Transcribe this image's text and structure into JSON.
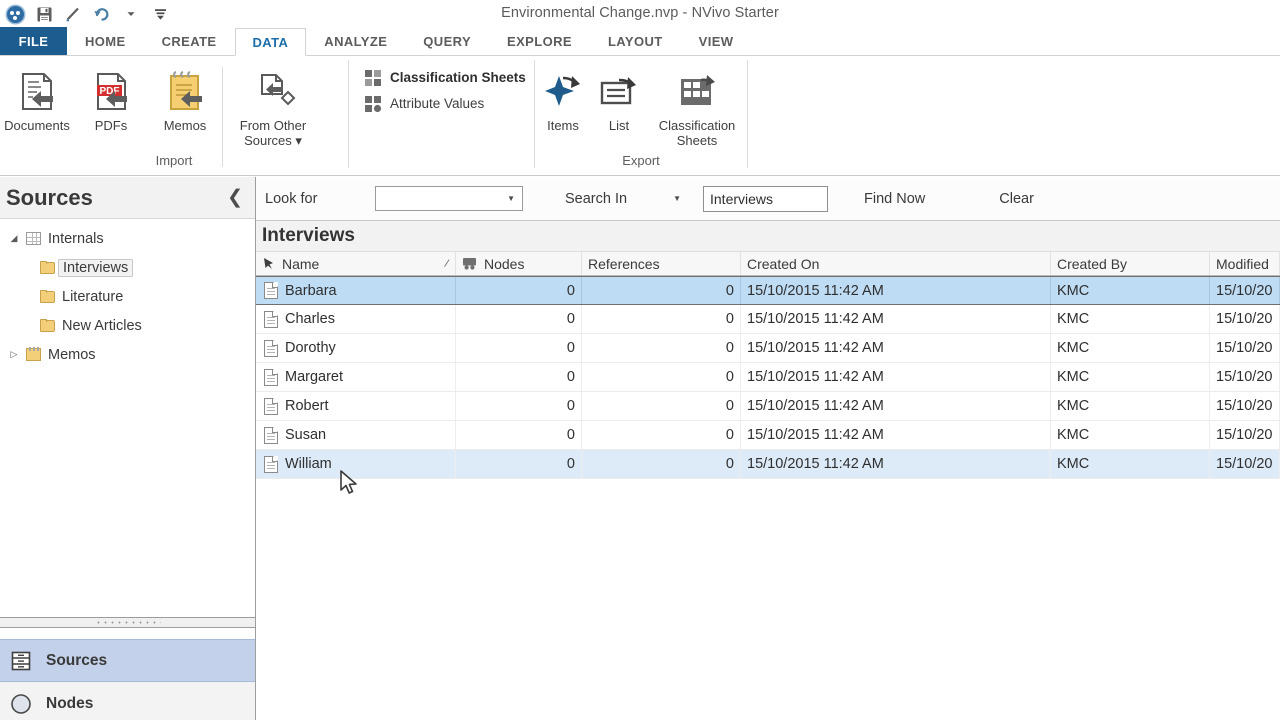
{
  "window": {
    "title": "Environmental Change.nvp - NVivo Starter"
  },
  "quick_access": {
    "items": [
      {
        "name": "app-orb",
        "label": "NVivo"
      },
      {
        "name": "save-icon",
        "label": "Save"
      },
      {
        "name": "format-painter-icon",
        "label": "Format Painter"
      },
      {
        "name": "undo-icon",
        "label": "Undo"
      },
      {
        "name": "undo-dropdown-caret",
        "label": ""
      },
      {
        "name": "customize-qat-icon",
        "label": "Customize Quick Access Toolbar"
      }
    ]
  },
  "ribbon_tabs": {
    "file": "FILE",
    "tabs": [
      {
        "label": "HOME",
        "active": false
      },
      {
        "label": "CREATE",
        "active": false
      },
      {
        "label": "DATA",
        "active": true
      },
      {
        "label": "ANALYZE",
        "active": false
      },
      {
        "label": "QUERY",
        "active": false
      },
      {
        "label": "EXPLORE",
        "active": false
      },
      {
        "label": "LAYOUT",
        "active": false
      },
      {
        "label": "VIEW",
        "active": false
      }
    ]
  },
  "ribbon": {
    "groups": [
      {
        "label": "Import",
        "big_buttons": [
          {
            "label": "Documents",
            "icon": "document-import-icon"
          },
          {
            "label": "PDFs",
            "icon": "pdf-import-icon"
          },
          {
            "label": "Memos",
            "icon": "memo-import-icon"
          },
          {
            "label": "From Other Sources",
            "icon": "from-other-sources-icon",
            "has_dropdown": true
          }
        ]
      },
      {
        "label": "",
        "small_buttons": [
          {
            "label": "Classification Sheets",
            "icon": "classification-sheets-icon",
            "bold": true
          },
          {
            "label": "Attribute Values",
            "icon": "attribute-values-icon",
            "bold": false
          }
        ]
      },
      {
        "label": "Export",
        "big_buttons": [
          {
            "label": "Items",
            "icon": "export-items-icon"
          },
          {
            "label": "List",
            "icon": "export-list-icon"
          },
          {
            "label": "Classification Sheets",
            "icon": "export-classification-sheets-icon"
          }
        ]
      }
    ]
  },
  "sidebar": {
    "title": "Sources",
    "collapse_icon": "chevron-left-icon",
    "tree": [
      {
        "label": "Internals",
        "icon": "internals-grid-icon",
        "level": 0,
        "expanded": true,
        "selected": false
      },
      {
        "label": "Interviews",
        "icon": "folder-icon",
        "level": 1,
        "selected": true
      },
      {
        "label": "Literature",
        "icon": "folder-icon",
        "level": 1,
        "selected": false
      },
      {
        "label": "New Articles",
        "icon": "folder-icon",
        "level": 1,
        "selected": false
      },
      {
        "label": "Memos",
        "icon": "memos-icon",
        "level": 0,
        "expanded": false,
        "selected": false
      }
    ],
    "nav_items": [
      {
        "label": "Sources",
        "icon": "sources-drawer-icon",
        "active": true
      },
      {
        "label": "Nodes",
        "icon": "nodes-circle-icon",
        "active": false
      }
    ]
  },
  "search": {
    "look_for_label": "Look for",
    "look_for_value": "",
    "look_for_caret": "caret-down-icon",
    "search_in_label": "Search In",
    "search_in_caret": "caret-down-icon",
    "scope_value": "Interviews",
    "find_now_label": "Find Now",
    "clear_label": "Clear"
  },
  "list_view": {
    "title": "Interviews",
    "columns": [
      {
        "key": "name",
        "label": "Name",
        "sorted": true,
        "sort_icon": "sort-ascending-icon",
        "header_icon": "pin-icon"
      },
      {
        "key": "nodes",
        "label": "Nodes",
        "header_icon": "nodes-icon"
      },
      {
        "key": "references",
        "label": "References"
      },
      {
        "key": "created_on",
        "label": "Created On"
      },
      {
        "key": "created_by",
        "label": "Created By"
      },
      {
        "key": "modified_on",
        "label": "Modified"
      }
    ],
    "rows": [
      {
        "name": "Barbara",
        "nodes": "0",
        "references": "0",
        "created_on": "15/10/2015 11:42 AM",
        "created_by": "KMC",
        "modified_on": "15/10/20",
        "state": "selected"
      },
      {
        "name": "Charles",
        "nodes": "0",
        "references": "0",
        "created_on": "15/10/2015 11:42 AM",
        "created_by": "KMC",
        "modified_on": "15/10/20",
        "state": "normal"
      },
      {
        "name": "Dorothy",
        "nodes": "0",
        "references": "0",
        "created_on": "15/10/2015 11:42 AM",
        "created_by": "KMC",
        "modified_on": "15/10/20",
        "state": "normal"
      },
      {
        "name": "Margaret",
        "nodes": "0",
        "references": "0",
        "created_on": "15/10/2015 11:42 AM",
        "created_by": "KMC",
        "modified_on": "15/10/20",
        "state": "normal"
      },
      {
        "name": "Robert",
        "nodes": "0",
        "references": "0",
        "created_on": "15/10/2015 11:42 AM",
        "created_by": "KMC",
        "modified_on": "15/10/20",
        "state": "normal"
      },
      {
        "name": "Susan",
        "nodes": "0",
        "references": "0",
        "created_on": "15/10/2015 11:42 AM",
        "created_by": "KMC",
        "modified_on": "15/10/20",
        "state": "normal"
      },
      {
        "name": "William",
        "nodes": "0",
        "references": "0",
        "created_on": "15/10/2015 11:42 AM",
        "created_by": "KMC",
        "modified_on": "15/10/20",
        "state": "hover"
      }
    ]
  },
  "colors": {
    "file_tab": "#1d5c8e",
    "active_tab_text": "#1d6ea8",
    "selection": "#bfdcf5",
    "hover": "#ddebf9",
    "nav_active": "#c3d2ea",
    "folder": "#f3cf7a"
  }
}
